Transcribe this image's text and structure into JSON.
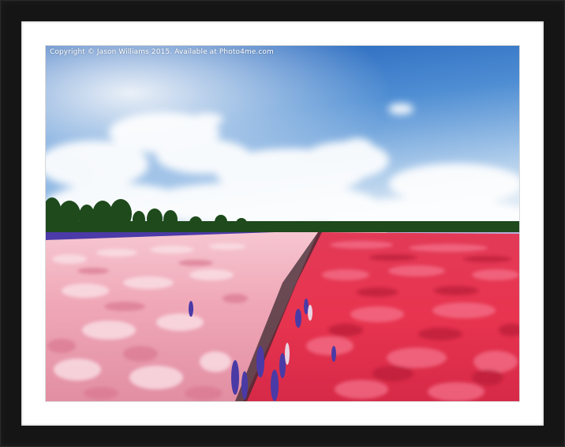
{
  "watermark": {
    "text": "Copyright © Jason Williams 2015. Available at Photo4me.com"
  },
  "colors": {
    "frame": "#151515",
    "mat": "#ffffff",
    "sky_top": "#2a6bc4",
    "pink_field": "#f2a7b8",
    "red_field": "#e8304f",
    "purple_strip": "#4b3aa8"
  },
  "photo": {
    "subject": "flower-field",
    "elements": [
      "sky-with-clouds",
      "tree-line",
      "pink-flower-rows",
      "red-flower-rows",
      "purple-flowers"
    ]
  }
}
